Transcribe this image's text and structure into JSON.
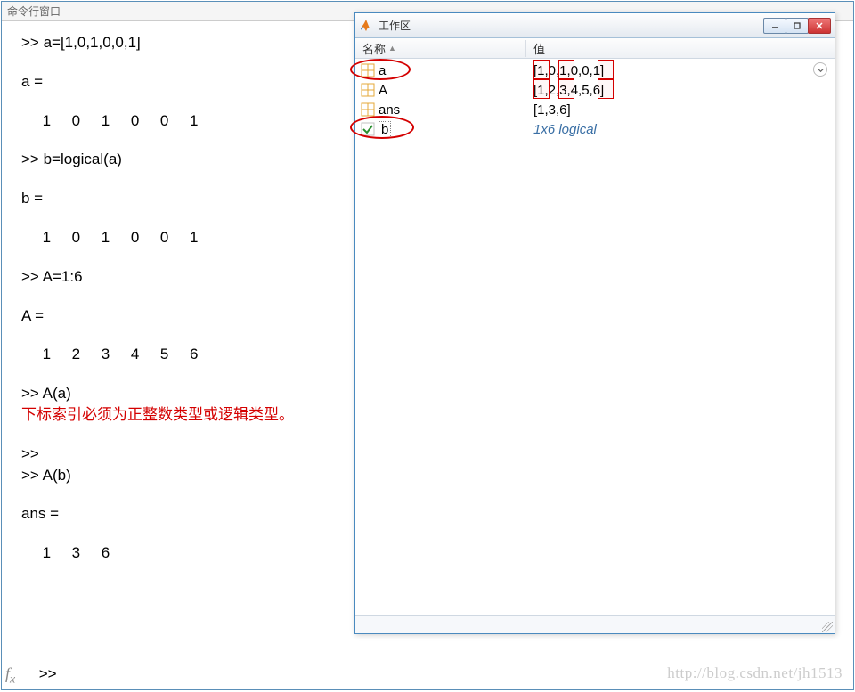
{
  "command_window": {
    "title": "命令行窗口",
    "lines": {
      "l1": ">> a=[1,0,1,0,0,1]",
      "l2": "a =",
      "l3": "     1     0     1     0     0     1",
      "l4": ">> b=logical(a)",
      "l5": "b =",
      "l6": "     1     0     1     0     0     1",
      "l7": ">> A=1:6",
      "l8": "A =",
      "l9": "     1     2     3     4     5     6",
      "l10": ">> A(a)",
      "err": "下标索引必须为正整数类型或逻辑类型。",
      "l11": ">>",
      "l12": ">> A(b)",
      "l13": "ans =",
      "l14": "     1     3     6",
      "prompt": ">>"
    },
    "fx_label": "fx"
  },
  "workspace": {
    "title": "工作区",
    "columns": {
      "name": "名称",
      "value": "值"
    },
    "rows": [
      {
        "name": "a",
        "value": "[1,0,1,0,0,1]",
        "type": "double"
      },
      {
        "name": "A",
        "value": "[1,2,3,4,5,6]",
        "type": "double"
      },
      {
        "name": "ans",
        "value": "[1,3,6]",
        "type": "double"
      },
      {
        "name": "b",
        "value": "1x6 logical",
        "type": "logical"
      }
    ]
  },
  "watermark": "http://blog.csdn.net/jh1513"
}
